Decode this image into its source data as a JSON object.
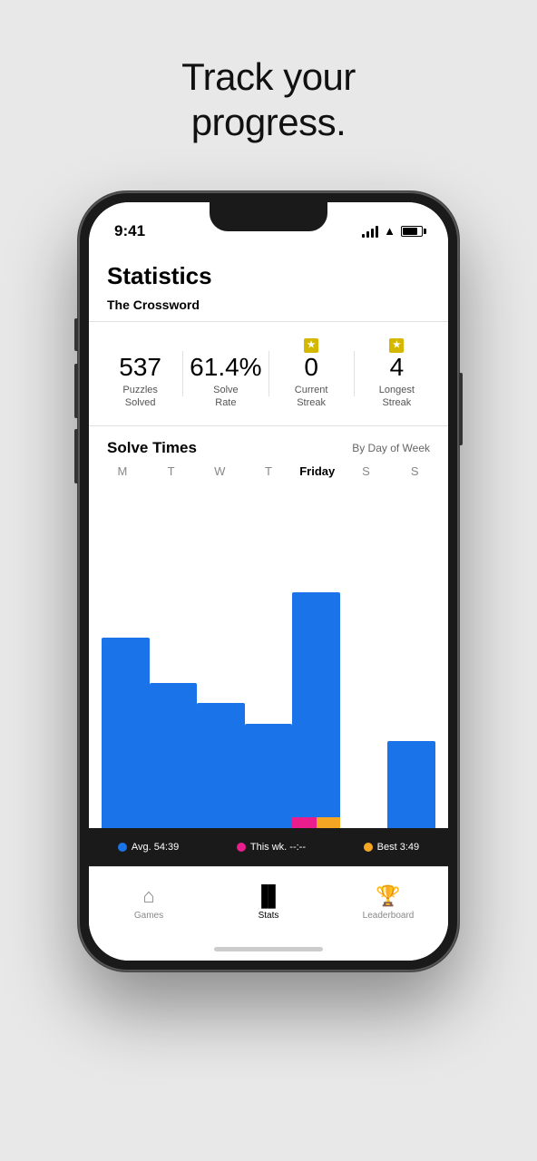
{
  "headline": {
    "line1": "Track your",
    "line2": "progress."
  },
  "phone": {
    "status": {
      "time": "9:41"
    },
    "screen": {
      "title": "Statistics",
      "section": "The Crossword",
      "stats": [
        {
          "value": "537",
          "label": "Puzzles\nSolved",
          "has_star": false
        },
        {
          "value": "61.4%",
          "label": "Solve\nRate",
          "has_star": false
        },
        {
          "value": "0",
          "label": "Current\nStreak",
          "has_star": true
        },
        {
          "value": "4",
          "label": "Longest\nStreak",
          "has_star": true
        }
      ],
      "chart": {
        "title": "Solve Times",
        "filter": "By Day of Week",
        "days": [
          "M",
          "T",
          "W",
          "T",
          "Friday",
          "S",
          "S"
        ],
        "active_day": "Friday",
        "legend": [
          {
            "color": "blue",
            "label": "Avg. 54:39"
          },
          {
            "color": "pink",
            "label": "This wk. --:--"
          },
          {
            "color": "gold",
            "label": "Best 3:49"
          }
        ]
      },
      "nav": [
        {
          "icon": "🏠",
          "label": "Games",
          "active": false
        },
        {
          "icon": "📊",
          "label": "Stats",
          "active": true
        },
        {
          "icon": "🏆",
          "label": "Leaderboard",
          "active": false
        }
      ]
    }
  }
}
